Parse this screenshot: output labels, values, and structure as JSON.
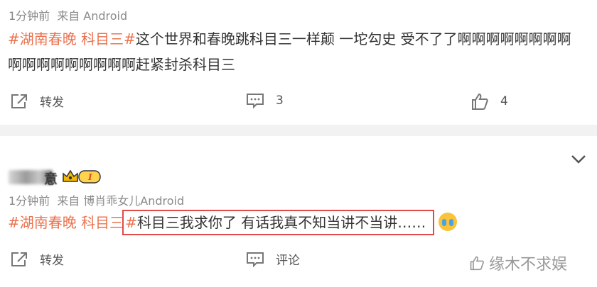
{
  "post1": {
    "meta": {
      "time": "1分钟前",
      "source": "来自 Android"
    },
    "tag": "#湖南春晚 科目三#",
    "body": "这个世界和春晚跳科目三一样颠 一坨勾史 受不了了啊啊啊啊啊啊啊啊啊啊啊啊啊啊啊啊啊赶紧封杀科目三",
    "actions": {
      "repost_label": "转发",
      "comment_count": "3",
      "like_count": "4"
    }
  },
  "post2": {
    "username_tail": "意",
    "meta": {
      "time": "1分钟前",
      "source": "来自 博肖乖女儿Android"
    },
    "tag": "#湖南春晚 科目三",
    "hash_close": "#",
    "body": "科目三我求你了 有话我真不知当讲不当讲……",
    "actions": {
      "repost_label": "转发",
      "comment_label": "评论"
    }
  },
  "vip_badge_text": "I",
  "watermark": "缘木不求娱",
  "colors": {
    "tag": "#eb7350",
    "highlight_border": "#e24a4a",
    "meta": "#8a8a8a"
  }
}
